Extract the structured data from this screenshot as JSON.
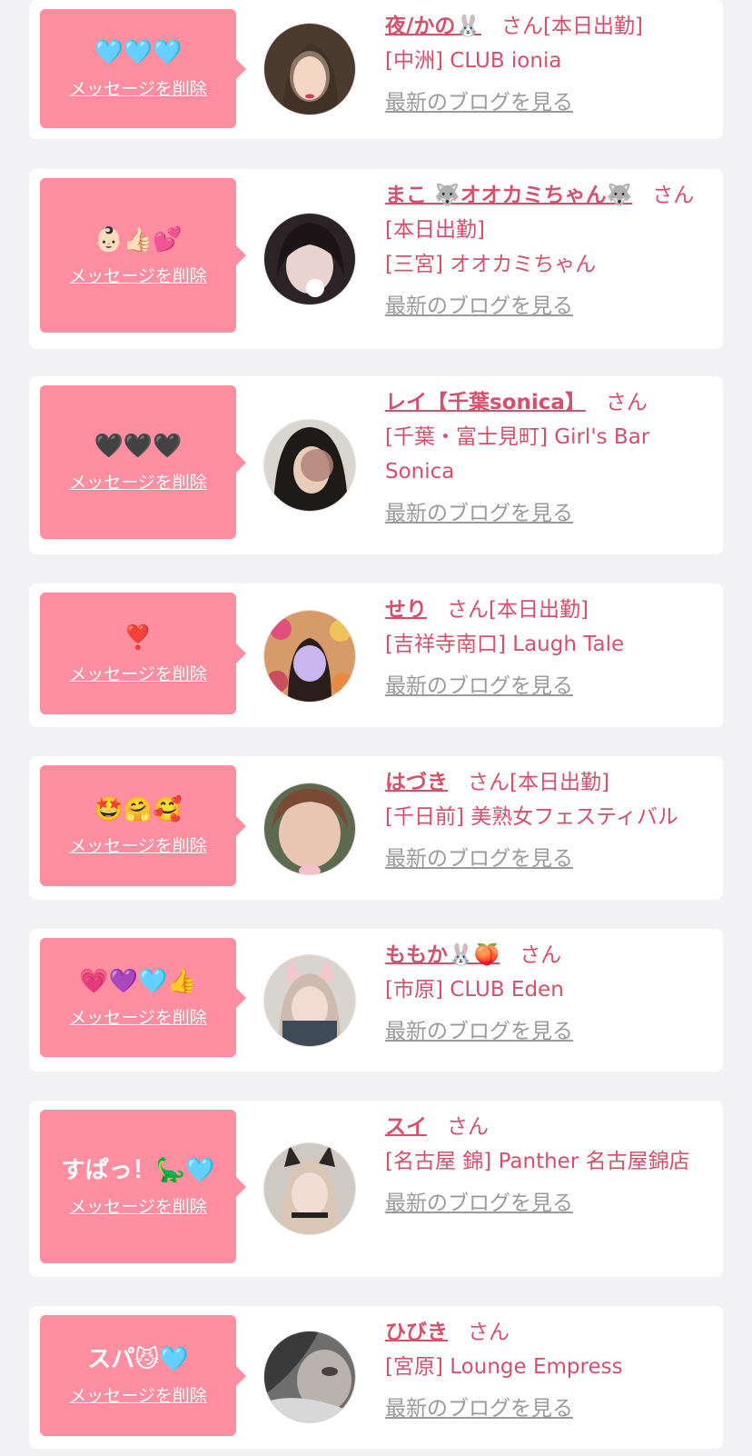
{
  "delete_label": "メッセージを削除",
  "blog_label": "最新のブログを見る",
  "san_label": "さん",
  "colors": {
    "accent": "#d6506b",
    "bubble": "#ff8ea0",
    "link_gray": "#9a9a9a"
  },
  "entries": [
    {
      "message": "🩵🩵🩵",
      "name": "夜/かの🐰",
      "status": "[本日出勤]",
      "shop": "[中洲] CLUB ionia"
    },
    {
      "message": "👶🏻👍🏻💕",
      "name": "まこ 🐺オオカミちゃん🐺",
      "status": "[本日出勤]",
      "shop": "[三宮] オオカミちゃん"
    },
    {
      "message": "🖤🖤🖤",
      "name": "レイ【千葉sonica】",
      "status": "",
      "shop": "[千葉・富士見町] Girl's Bar Sonica"
    },
    {
      "message": "❣️",
      "name": "せり",
      "status": "[本日出勤]",
      "shop": "[吉祥寺南口] Laugh Tale"
    },
    {
      "message": "🤩🤗🥰",
      "name": "はづき",
      "status": "[本日出勤]",
      "shop": "[千日前] 美熟女フェスティバル"
    },
    {
      "message": "💗💜🩵👍",
      "name": "ももか🐰🍑",
      "status": "",
      "shop": "[市原] CLUB Eden"
    },
    {
      "message": "すぱっ！🦕🩵",
      "name": "スイ",
      "status": "",
      "shop": "[名古屋 錦] Panther 名古屋錦店"
    },
    {
      "message": "スパ😼🩵",
      "name": "ひびき",
      "status": "",
      "shop": "[宮原] Lounge Empress"
    }
  ]
}
